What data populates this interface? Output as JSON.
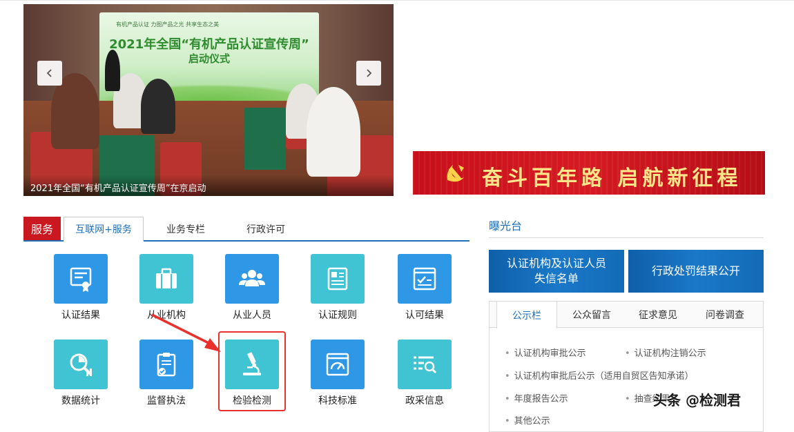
{
  "carousel": {
    "screen_line": "有机产品认证 力图产品之光 共享生态之美",
    "screen_title": "2021年全国“有机产品认证宣传周”",
    "screen_subtitle": "启动仪式",
    "caption": "2021年全国“有机产品认证宣传周”在京启动"
  },
  "banner": {
    "slogan": "奋斗百年路 启航新征程"
  },
  "service": {
    "label": "服务",
    "tabs": [
      "互联网+服务",
      "业务专栏",
      "行政许可"
    ],
    "items": [
      {
        "name": "认证结果",
        "icon": "certificate-icon",
        "color": "blue"
      },
      {
        "name": "从业机构",
        "icon": "briefcase-icon",
        "color": "teal"
      },
      {
        "name": "从业人员",
        "icon": "people-icon",
        "color": "blue"
      },
      {
        "name": "认证规则",
        "icon": "rules-document-icon",
        "color": "teal"
      },
      {
        "name": "认可结果",
        "icon": "checklist-icon",
        "color": "blue"
      },
      {
        "name": "数据统计",
        "icon": "data-search-icon",
        "color": "teal"
      },
      {
        "name": "监督执法",
        "icon": "clipboard-check-icon",
        "color": "blue"
      },
      {
        "name": "检验检测",
        "icon": "microscope-icon",
        "color": "teal"
      },
      {
        "name": "科技标准",
        "icon": "gauge-window-icon",
        "color": "blue"
      },
      {
        "name": "政采信息",
        "icon": "list-search-icon",
        "color": "teal"
      }
    ]
  },
  "expose": {
    "title": "曝光台",
    "btn1_line1": "认证机构及认证人员",
    "btn1_line2": "失信名单",
    "btn2": "行政处罚结果公开"
  },
  "notice": {
    "tabs": [
      "公示栏",
      "公众留言",
      "征求意见",
      "问卷调查"
    ],
    "links": [
      "认证机构审批公示",
      "认证机构注销公示",
      "认证机构审批后公示（适用自贸区告知承诺）",
      "年度报告公示",
      "抽查结果",
      "其他公示"
    ]
  },
  "watermark": "头条 @检测君",
  "colors": {
    "blue": "#2e98e6",
    "teal": "#40c3d2",
    "red": "#c9181f",
    "accent": "#1e6fb8"
  }
}
